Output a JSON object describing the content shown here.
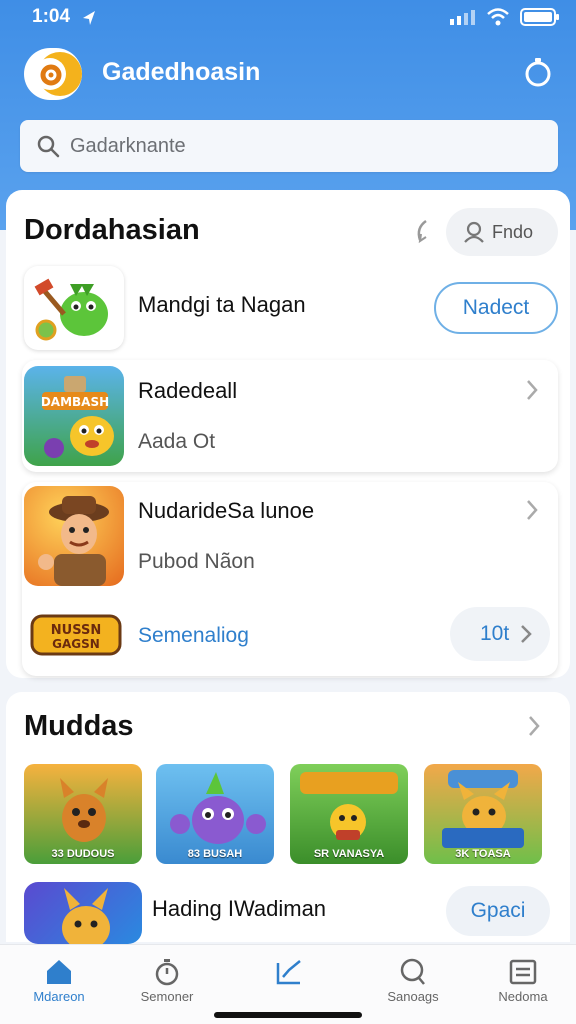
{
  "status_bar": {
    "time": "1:04"
  },
  "header": {
    "title": "Gadedhoasin"
  },
  "search": {
    "placeholder": "Gadarknante"
  },
  "section1": {
    "title": "Dordahasian",
    "find_label": "Fndo",
    "featured": {
      "title": "Mandgi ta Nagan",
      "button": "Nadect"
    },
    "item1": {
      "title": "Radedeall",
      "subtitle": "Aada Ot"
    },
    "item2": {
      "title": "NudarideSa lunoe",
      "subtitle": "Pubod Nãon",
      "link": "Semenaliog",
      "count": "10t"
    }
  },
  "section2": {
    "title": "Muddas",
    "tiles": [
      {
        "label": "DUDOUS",
        "badge": "33"
      },
      {
        "label": "BUSAH",
        "badge": "83"
      },
      {
        "label": "VANASYA",
        "badge": "SR"
      },
      {
        "label": "TOASA",
        "badge": "3K"
      }
    ],
    "row": {
      "title": "Hading IWadiman",
      "button": "Gpaci"
    }
  },
  "nav": {
    "items": [
      {
        "label": "Mdareon",
        "icon": "home-icon",
        "active": true
      },
      {
        "label": "Semoner",
        "icon": "clock-icon"
      },
      {
        "label": "",
        "icon": "chart-icon"
      },
      {
        "label": "Sanoags",
        "icon": "search-icon"
      },
      {
        "label": "Nedoma",
        "icon": "list-icon"
      }
    ]
  },
  "colors": {
    "accent": "#2f7fcc",
    "header_bg": "#4a95e9",
    "text": "#111111"
  }
}
